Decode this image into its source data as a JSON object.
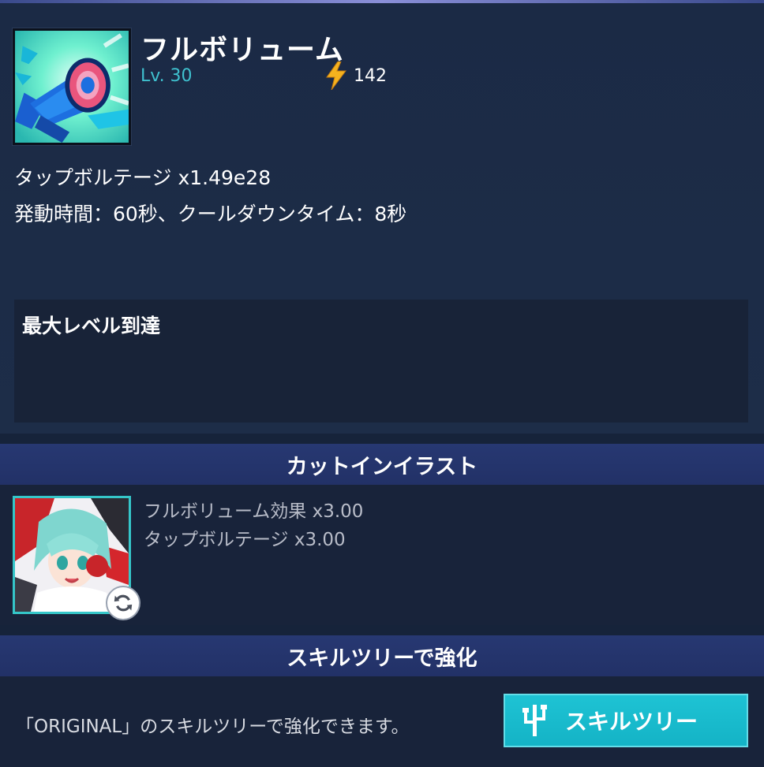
{
  "skill": {
    "name": "フルボリューム",
    "level": "Lv. 30",
    "cost": "142",
    "icon": "megaphone-icon",
    "description_1": "タップボルテージ x1.49e28",
    "description_2": "発動時間：60秒、クールダウンタイム：8秒",
    "status": "最大レベル到達"
  },
  "cutin": {
    "header": "カットインイラスト",
    "bonus_1": "フルボリューム効果 x3.00",
    "bonus_2": "タップボルテージ x3.00"
  },
  "skill_tree": {
    "header": "スキルツリーで強化",
    "description": "「ORIGINAL」のスキルツリーで強化できます。",
    "button_label": "スキルツリー"
  },
  "colors": {
    "accent_cyan": "#1ec3d4",
    "level_text": "#3fc1cf",
    "header_bar": "#273872",
    "bolt": "#f5b21e"
  }
}
